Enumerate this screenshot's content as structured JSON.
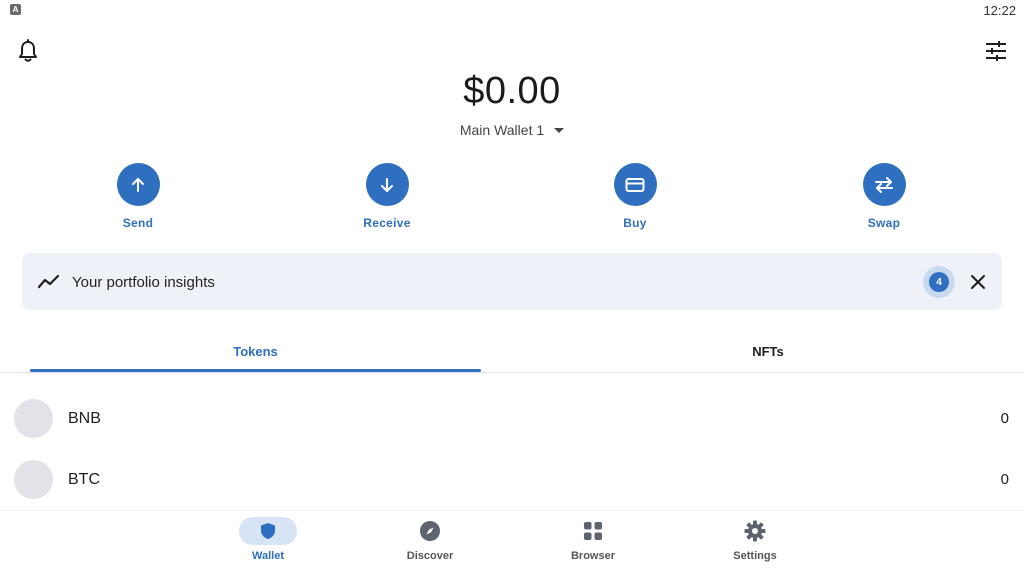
{
  "status_bar": {
    "time": "12:22",
    "app_icon_letter": "A"
  },
  "header": {
    "left_icon": "bell-icon",
    "right_icon": "sliders-icon"
  },
  "balance": {
    "amount": "$0.00"
  },
  "wallet": {
    "name": "Main Wallet 1"
  },
  "actions": [
    {
      "label": "Send",
      "icon": "arrow-up-icon"
    },
    {
      "label": "Receive",
      "icon": "arrow-down-icon"
    },
    {
      "label": "Buy",
      "icon": "card-icon"
    },
    {
      "label": "Swap",
      "icon": "swap-icon"
    }
  ],
  "insights": {
    "text": "Your portfolio insights",
    "badge_count": "4"
  },
  "tabs": [
    {
      "label": "Tokens",
      "active": true
    },
    {
      "label": "NFTs",
      "active": false
    }
  ],
  "tokens": [
    {
      "symbol": "BNB",
      "balance": "0"
    },
    {
      "symbol": "BTC",
      "balance": "0"
    }
  ],
  "bottom_nav": [
    {
      "label": "Wallet",
      "icon": "shield-icon",
      "active": true
    },
    {
      "label": "Discover",
      "icon": "compass-icon",
      "active": false
    },
    {
      "label": "Browser",
      "icon": "grid-icon",
      "active": false
    },
    {
      "label": "Settings",
      "icon": "gear-icon",
      "active": false
    }
  ],
  "colors": {
    "accent": "#2f6fbf",
    "insights_bg": "#eef2f8",
    "nav_active_bg": "#d7e4f6"
  }
}
